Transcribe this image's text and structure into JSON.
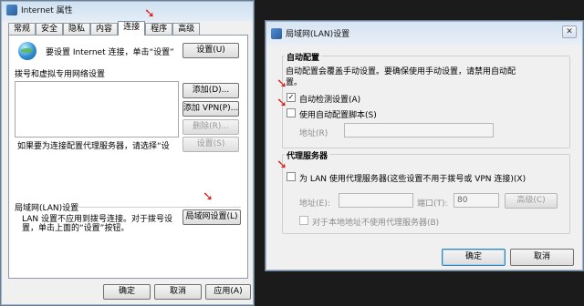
{
  "window1": {
    "title": "Internet 属性",
    "tabs": [
      "常规",
      "安全",
      "隐私",
      "内容",
      "连接",
      "程序",
      "高级"
    ],
    "setup_text": "要设置 Internet 连接，单击“设置”",
    "setup_button": "设置(U)",
    "dialup_label": "拨号和虚拟专用网络设置",
    "add_button": "添加(D)...",
    "add_vpn_button": "添加 VPN(P)...",
    "delete_button": "删除(R)...",
    "proxy_hint": "如果要为连接配置代理服务器，请选择“设",
    "settings_button": "设置(S)",
    "lan_label": "局域网(LAN)设置",
    "lan_text_line1": "LAN 设置不应用到拨号连接。对于拨号设",
    "lan_text_line2": "置，单击上面的“设置”按钮。",
    "lan_button": "局域网设置(L)",
    "ok_button": "确定",
    "cancel_button": "取消",
    "apply_button": "应用(A)"
  },
  "window2": {
    "title": "局域网(LAN)设置",
    "auto_group": "自动配置",
    "auto_desc_line1": "自动配置会覆盖手动设置。要确保使用手动设置，请禁用自动配",
    "auto_desc_line2": "置。",
    "auto_detect_label": "自动检测设置(A)",
    "auto_detect_checked": "✓",
    "use_script_label": "使用自动配置脚本(S)",
    "address_label": "地址(R)",
    "proxy_group": "代理服务器",
    "use_proxy_label": "为 LAN 使用代理服务器(这些设置不用于拨号或 VPN 连接)(X)",
    "proxy_address_label": "地址(E):",
    "port_label": "端口(T):",
    "port_value": "80",
    "advanced_button": "高级(C)",
    "bypass_label": "对于本地地址不使用代理服务器(B)",
    "ok_button": "确定",
    "cancel_button": "取消"
  },
  "icons": {
    "close": "✕",
    "arrow": "➘"
  },
  "colors": {
    "annotation_arrow": "#e01e1e",
    "title_bar": "#dbe7f3"
  }
}
